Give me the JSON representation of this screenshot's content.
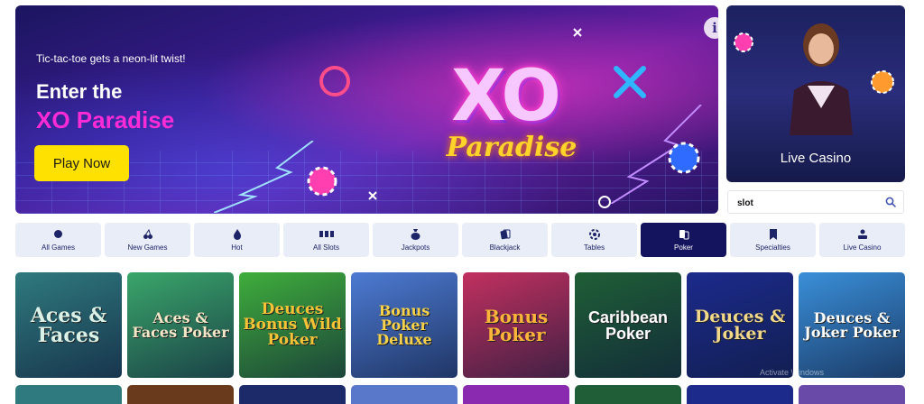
{
  "hero": {
    "subtitle": "Tic-tac-toe gets a neon-lit twist!",
    "title_line1": "Enter the",
    "title_line2": "XO Paradise",
    "cta_label": "Play Now",
    "logo_main": "XO",
    "logo_script": "Paradise",
    "info_glyph": "i",
    "accent_color": "#ff2bd6",
    "cta_color": "#ffe100"
  },
  "live_casino": {
    "label": "Live Casino"
  },
  "search": {
    "value": "slot",
    "icon": "search-icon"
  },
  "tabs": [
    {
      "label": "All Games",
      "icon": "circle-icon"
    },
    {
      "label": "New Games",
      "icon": "cherries-icon"
    },
    {
      "label": "Hot",
      "icon": "flame-icon"
    },
    {
      "label": "All Slots",
      "icon": "slot-reels-icon"
    },
    {
      "label": "Jackpots",
      "icon": "money-bag-icon"
    },
    {
      "label": "Blackjack",
      "icon": "playing-cards-icon"
    },
    {
      "label": "Tables",
      "icon": "chip-icon"
    },
    {
      "label": "Poker",
      "icon": "poker-cards-icon",
      "active": true
    },
    {
      "label": "Specialties",
      "icon": "bookmark-icon"
    },
    {
      "label": "Live Casino",
      "icon": "dealer-icon"
    }
  ],
  "games": [
    {
      "title": "Aces & Faces",
      "bg": "#2f7a7e",
      "fg": "#d9f1e6"
    },
    {
      "title": "Aces & Faces Poker",
      "bg": "#3aa66a",
      "fg": "#f4e6c6"
    },
    {
      "title": "Deuces Bonus Wild Poker",
      "bg": "#3fae3b",
      "fg": "#f6c236"
    },
    {
      "title": "Bonus Poker Deluxe",
      "bg": "#4d7bd3",
      "fg": "#f7d24a"
    },
    {
      "title": "Bonus Poker",
      "bg": "#c2305f",
      "fg": "#ffb43a"
    },
    {
      "title": "Caribbean Poker",
      "bg": "#1f5e36",
      "fg": "#ffffff"
    },
    {
      "title": "Deuces & Joker",
      "bg": "#1c2a8c",
      "fg": "#f2d98a"
    },
    {
      "title": "Deuces & Joker Poker",
      "bg": "#3a8fd9",
      "fg": "#ffffff"
    }
  ],
  "row2_colors": [
    "#2f7a7e",
    "#6a3a1c",
    "#1d2a6a",
    "#5a78c9",
    "#8a2ab0",
    "#1f5e36",
    "#1c2a8c",
    "#6a4aa8"
  ],
  "watermark": "Activate Windows"
}
